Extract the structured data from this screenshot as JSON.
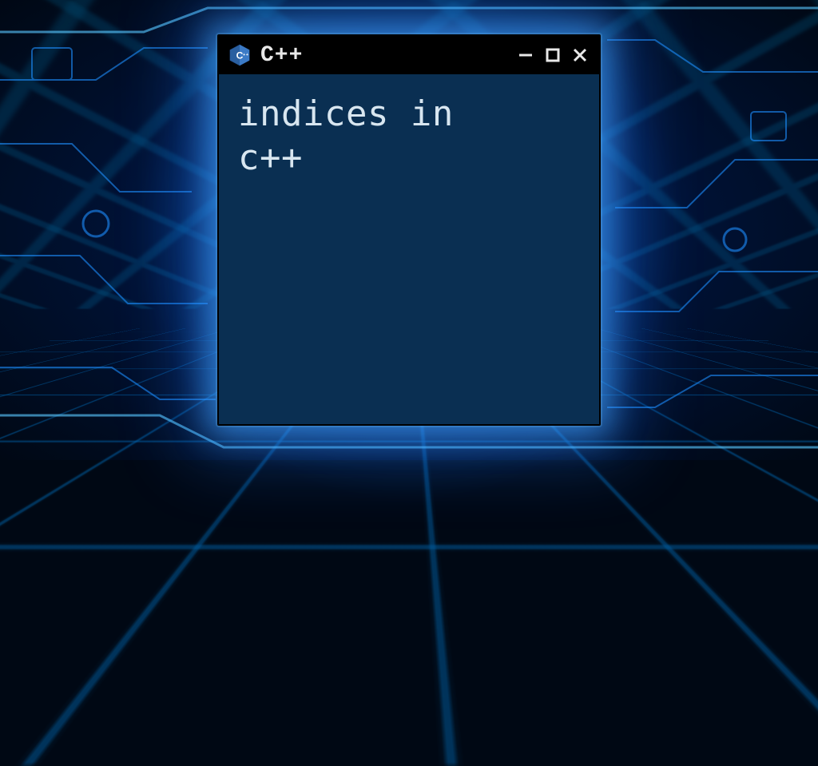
{
  "window": {
    "title": "C++",
    "icon_name": "cpp-logo-icon",
    "content_text": "indices in\nc++"
  },
  "colors": {
    "window_bg": "#0a2f52",
    "titlebar_bg": "#000000",
    "text": "#d8e6f0",
    "glow": "#3aa8ff"
  }
}
